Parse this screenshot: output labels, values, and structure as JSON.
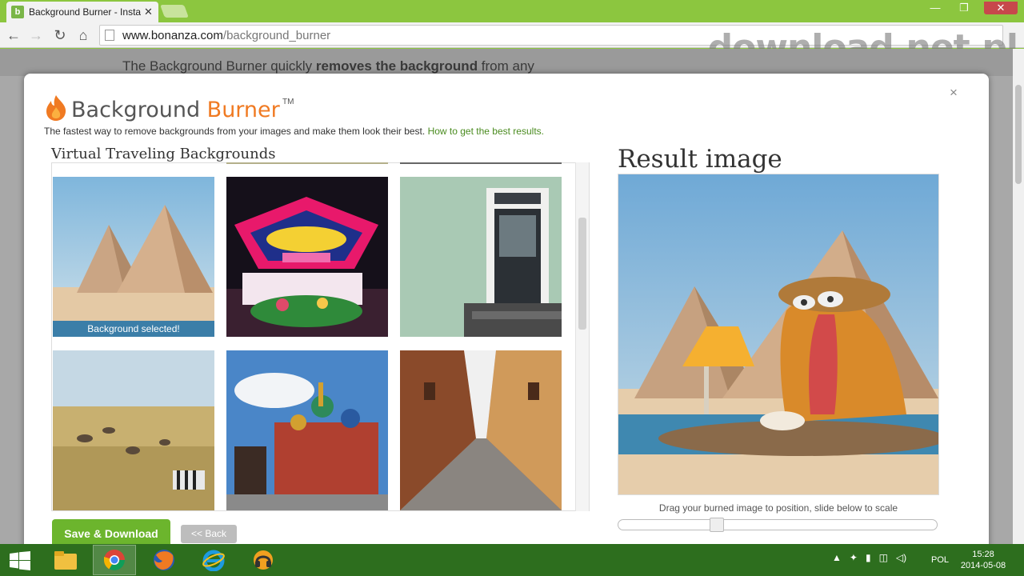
{
  "browser": {
    "tab_title": "Background Burner - Insta",
    "tab_favicon": "b",
    "url_host": "www.bonanza.com",
    "url_path": "/background_burner",
    "watermark": "download.net.pl"
  },
  "page_behind": {
    "text_before": "The Background Burner quickly ",
    "text_bold": "removes the background",
    "text_after": " from any"
  },
  "modal": {
    "close": "×",
    "logo_word1": "Background",
    "logo_word2": "Burner",
    "logo_tm": "TM",
    "tagline": "The fastest way to remove backgrounds from your images and make them look their best.",
    "tagline_link": "How to get the best results.",
    "gallery_title": "Virtual Traveling Backgrounds",
    "selected_caption": "Background selected!",
    "result_title": "Result image",
    "drag_hint": "Drag your burned image to position, slide below to scale",
    "save_label": "Save & Download",
    "back_label": "<< Back",
    "scale_slider_value": 0.3
  },
  "taskbar": {
    "lang": "POL",
    "time": "15:28",
    "date": "2014-05-08"
  },
  "colors": {
    "chrome_green": "#8cc63f",
    "brand_orange": "#f07a22",
    "save_green": "#6cb52d",
    "selected_blue": "#3b7ea8",
    "taskbar_green": "#2d6e1e"
  }
}
